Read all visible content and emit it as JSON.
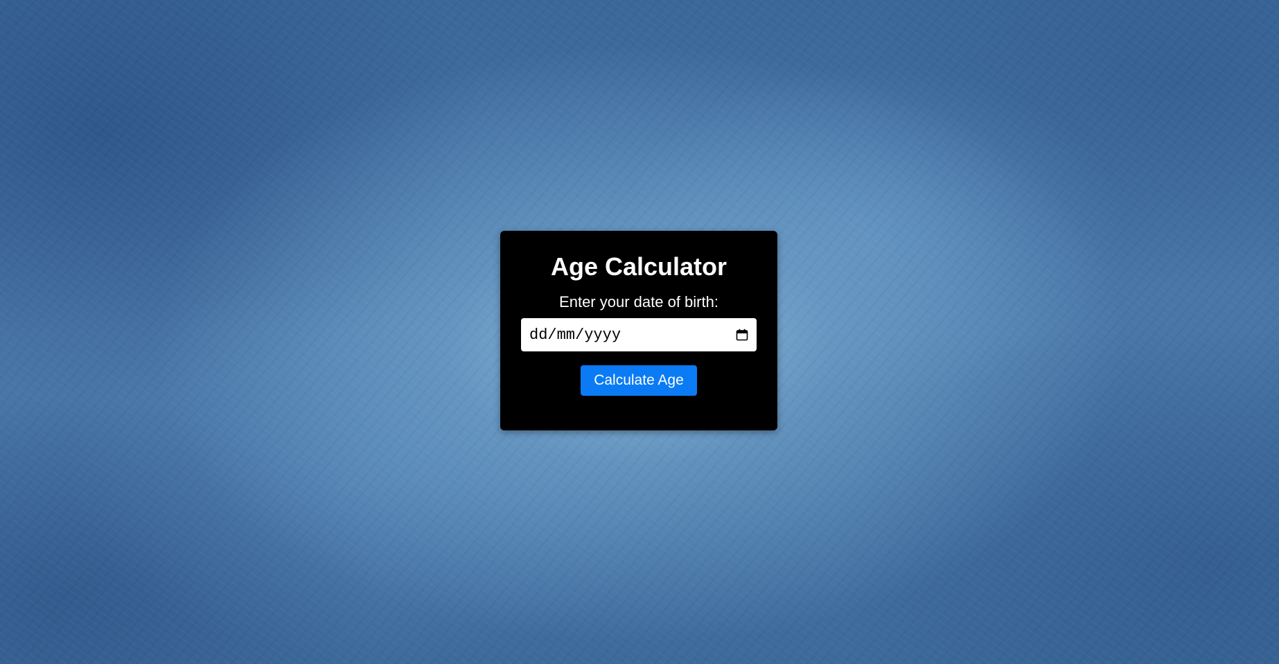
{
  "page": {
    "background_color": "#3f6c9c"
  },
  "card": {
    "title": "Age Calculator",
    "dob_label": "Enter your date of birth:",
    "dob_input": {
      "placeholder": "dd/mm/yyyy",
      "value": "",
      "icon": "calendar-icon"
    },
    "calculate_button": {
      "label": "Calculate Age",
      "color": "#0a7bf5"
    }
  }
}
